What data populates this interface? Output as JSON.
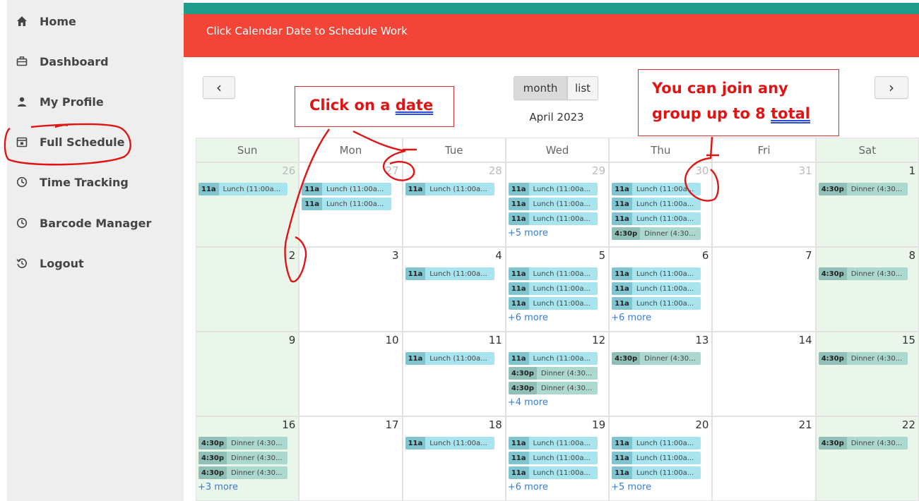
{
  "sidebar": {
    "items": [
      {
        "label": "Home",
        "icon": "home-icon"
      },
      {
        "label": "Dashboard",
        "icon": "briefcase-icon"
      },
      {
        "label": "My Profile",
        "icon": "user-icon"
      },
      {
        "label": "Full Schedule",
        "icon": "calendar-icon"
      },
      {
        "label": "Time Tracking",
        "icon": "clock-icon"
      },
      {
        "label": "Barcode Manager",
        "icon": "clock-icon"
      },
      {
        "label": "Logout",
        "icon": "history-icon"
      }
    ]
  },
  "banner": {
    "text": "Click Calendar Date to Schedule Work"
  },
  "toolbar": {
    "prev_label": "‹",
    "next_label": "›",
    "month_label": "month",
    "list_label": "list",
    "title": "April 2023"
  },
  "calendar": {
    "weekdays": [
      "Sun",
      "Mon",
      "Tue",
      "Wed",
      "Thu",
      "Fri",
      "Sat"
    ],
    "weeks": [
      [
        {
          "day": "26",
          "other": true,
          "events": [
            {
              "time": "11a",
              "title": "Lunch (11:00a...",
              "kind": "lunch"
            }
          ]
        },
        {
          "day": "27",
          "other": true,
          "events": [
            {
              "time": "11a",
              "title": "Lunch (11:00a...",
              "kind": "lunch"
            },
            {
              "time": "11a",
              "title": "Lunch (11:00a...",
              "kind": "lunch"
            }
          ]
        },
        {
          "day": "28",
          "other": true,
          "events": [
            {
              "time": "11a",
              "title": "Lunch (11:00a...",
              "kind": "lunch"
            }
          ]
        },
        {
          "day": "29",
          "other": true,
          "events": [
            {
              "time": "11a",
              "title": "Lunch (11:00a...",
              "kind": "lunch"
            },
            {
              "time": "11a",
              "title": "Lunch (11:00a...",
              "kind": "lunch"
            },
            {
              "time": "11a",
              "title": "Lunch (11:00a...",
              "kind": "lunch"
            }
          ],
          "more": "+5 more"
        },
        {
          "day": "30",
          "other": true,
          "events": [
            {
              "time": "11a",
              "title": "Lunch (11:00a...",
              "kind": "lunch"
            },
            {
              "time": "11a",
              "title": "Lunch (11:00a...",
              "kind": "lunch"
            },
            {
              "time": "11a",
              "title": "Lunch (11:00a...",
              "kind": "lunch"
            },
            {
              "time": "4:30p",
              "title": "Dinner (4:30...",
              "kind": "dinner"
            }
          ]
        },
        {
          "day": "31",
          "other": true,
          "events": []
        },
        {
          "day": "1",
          "other": false,
          "events": [
            {
              "time": "4:30p",
              "title": "Dinner (4:30...",
              "kind": "dinner"
            }
          ]
        }
      ],
      [
        {
          "day": "2",
          "other": false,
          "events": []
        },
        {
          "day": "3",
          "other": false,
          "events": []
        },
        {
          "day": "4",
          "other": false,
          "events": [
            {
              "time": "11a",
              "title": "Lunch (11:00a...",
              "kind": "lunch"
            }
          ]
        },
        {
          "day": "5",
          "other": false,
          "events": [
            {
              "time": "11a",
              "title": "Lunch (11:00a...",
              "kind": "lunch"
            },
            {
              "time": "11a",
              "title": "Lunch (11:00a...",
              "kind": "lunch"
            },
            {
              "time": "11a",
              "title": "Lunch (11:00a...",
              "kind": "lunch"
            }
          ],
          "more": "+6 more"
        },
        {
          "day": "6",
          "other": false,
          "events": [
            {
              "time": "11a",
              "title": "Lunch (11:00a...",
              "kind": "lunch"
            },
            {
              "time": "11a",
              "title": "Lunch (11:00a...",
              "kind": "lunch"
            },
            {
              "time": "11a",
              "title": "Lunch (11:00a...",
              "kind": "lunch"
            }
          ],
          "more": "+6 more"
        },
        {
          "day": "7",
          "other": false,
          "events": []
        },
        {
          "day": "8",
          "other": false,
          "events": [
            {
              "time": "4:30p",
              "title": "Dinner (4:30...",
              "kind": "dinner"
            }
          ]
        }
      ],
      [
        {
          "day": "9",
          "other": false,
          "events": []
        },
        {
          "day": "10",
          "other": false,
          "events": []
        },
        {
          "day": "11",
          "other": false,
          "events": [
            {
              "time": "11a",
              "title": "Lunch (11:00a...",
              "kind": "lunch"
            }
          ]
        },
        {
          "day": "12",
          "other": false,
          "events": [
            {
              "time": "11a",
              "title": "Lunch (11:00a...",
              "kind": "lunch"
            },
            {
              "time": "4:30p",
              "title": "Dinner (4:30...",
              "kind": "dinner"
            },
            {
              "time": "4:30p",
              "title": "Dinner (4:30...",
              "kind": "dinner"
            }
          ],
          "more": "+4 more"
        },
        {
          "day": "13",
          "other": false,
          "events": [
            {
              "time": "4:30p",
              "title": "Dinner (4:30...",
              "kind": "dinner"
            }
          ]
        },
        {
          "day": "14",
          "other": false,
          "events": []
        },
        {
          "day": "15",
          "other": false,
          "events": [
            {
              "time": "4:30p",
              "title": "Dinner (4:30...",
              "kind": "dinner"
            }
          ]
        }
      ],
      [
        {
          "day": "16",
          "other": false,
          "events": [
            {
              "time": "4:30p",
              "title": "Dinner (4:30...",
              "kind": "dinner"
            },
            {
              "time": "4:30p",
              "title": "Dinner (4:30...",
              "kind": "dinner"
            },
            {
              "time": "4:30p",
              "title": "Dinner (4:30...",
              "kind": "dinner"
            }
          ],
          "more": "+3 more"
        },
        {
          "day": "17",
          "other": false,
          "events": []
        },
        {
          "day": "18",
          "other": false,
          "events": [
            {
              "time": "11a",
              "title": "Lunch (11:00a...",
              "kind": "lunch"
            }
          ]
        },
        {
          "day": "19",
          "other": false,
          "events": [
            {
              "time": "11a",
              "title": "Lunch (11:00a...",
              "kind": "lunch"
            },
            {
              "time": "11a",
              "title": "Lunch (11:00a...",
              "kind": "lunch"
            },
            {
              "time": "11a",
              "title": "Lunch (11:00a...",
              "kind": "lunch"
            }
          ],
          "more": "+6 more"
        },
        {
          "day": "20",
          "other": false,
          "events": [
            {
              "time": "11a",
              "title": "Lunch (11:00a...",
              "kind": "lunch"
            },
            {
              "time": "11a",
              "title": "Lunch (11:00a...",
              "kind": "lunch"
            },
            {
              "time": "11a",
              "title": "Lunch (11:00a...",
              "kind": "lunch"
            }
          ],
          "more": "+5 more"
        },
        {
          "day": "21",
          "other": false,
          "events": []
        },
        {
          "day": "22",
          "other": false,
          "events": [
            {
              "time": "4:30p",
              "title": "Dinner (4:30...",
              "kind": "dinner"
            }
          ]
        }
      ]
    ]
  },
  "annotations": {
    "callout1": {
      "prefix": "Click on a ",
      "underlined": "date"
    },
    "callout2": {
      "line1": "You can join any",
      "line2_prefix": "group up to 8 ",
      "line2_underlined": "total"
    }
  },
  "colors": {
    "banner": "#f24437",
    "stripe": "#1e9c89",
    "weekend": "#eaf6ea",
    "lunch_event": "#a8e4ee",
    "dinner_event": "#acd8d0",
    "annotation": "#e01414"
  }
}
